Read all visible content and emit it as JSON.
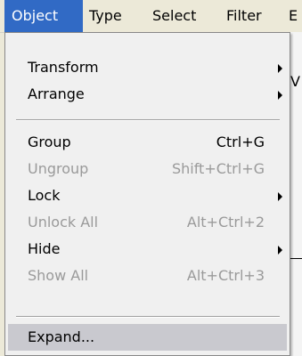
{
  "menubar": {
    "items": [
      {
        "label": "Object"
      },
      {
        "label": "Type"
      },
      {
        "label": "Select"
      },
      {
        "label": "Filter"
      },
      {
        "label": "E"
      }
    ]
  },
  "dropdown": {
    "items": [
      {
        "label": "Transform",
        "shortcut": "",
        "submenu": true,
        "disabled": false
      },
      {
        "label": "Arrange",
        "shortcut": "",
        "submenu": true,
        "disabled": false
      },
      {
        "label": "Group",
        "shortcut": "Ctrl+G",
        "submenu": false,
        "disabled": false
      },
      {
        "label": "Ungroup",
        "shortcut": "Shift+Ctrl+G",
        "submenu": false,
        "disabled": true
      },
      {
        "label": "Lock",
        "shortcut": "",
        "submenu": true,
        "disabled": false
      },
      {
        "label": "Unlock All",
        "shortcut": "Alt+Ctrl+2",
        "submenu": false,
        "disabled": true
      },
      {
        "label": "Hide",
        "shortcut": "",
        "submenu": true,
        "disabled": false
      },
      {
        "label": "Show All",
        "shortcut": "Alt+Ctrl+3",
        "submenu": false,
        "disabled": true
      },
      {
        "label": "Expand...",
        "shortcut": "",
        "submenu": false,
        "disabled": false
      }
    ]
  },
  "background": {
    "glyph": "V"
  },
  "colors": {
    "menubar_bg": "#ece9d8",
    "active_menu_bg": "#316ac5",
    "dropdown_bg": "#f0f0f0",
    "disabled_text": "#9a9a9a",
    "highlight_bg": "#c9c9cf"
  }
}
